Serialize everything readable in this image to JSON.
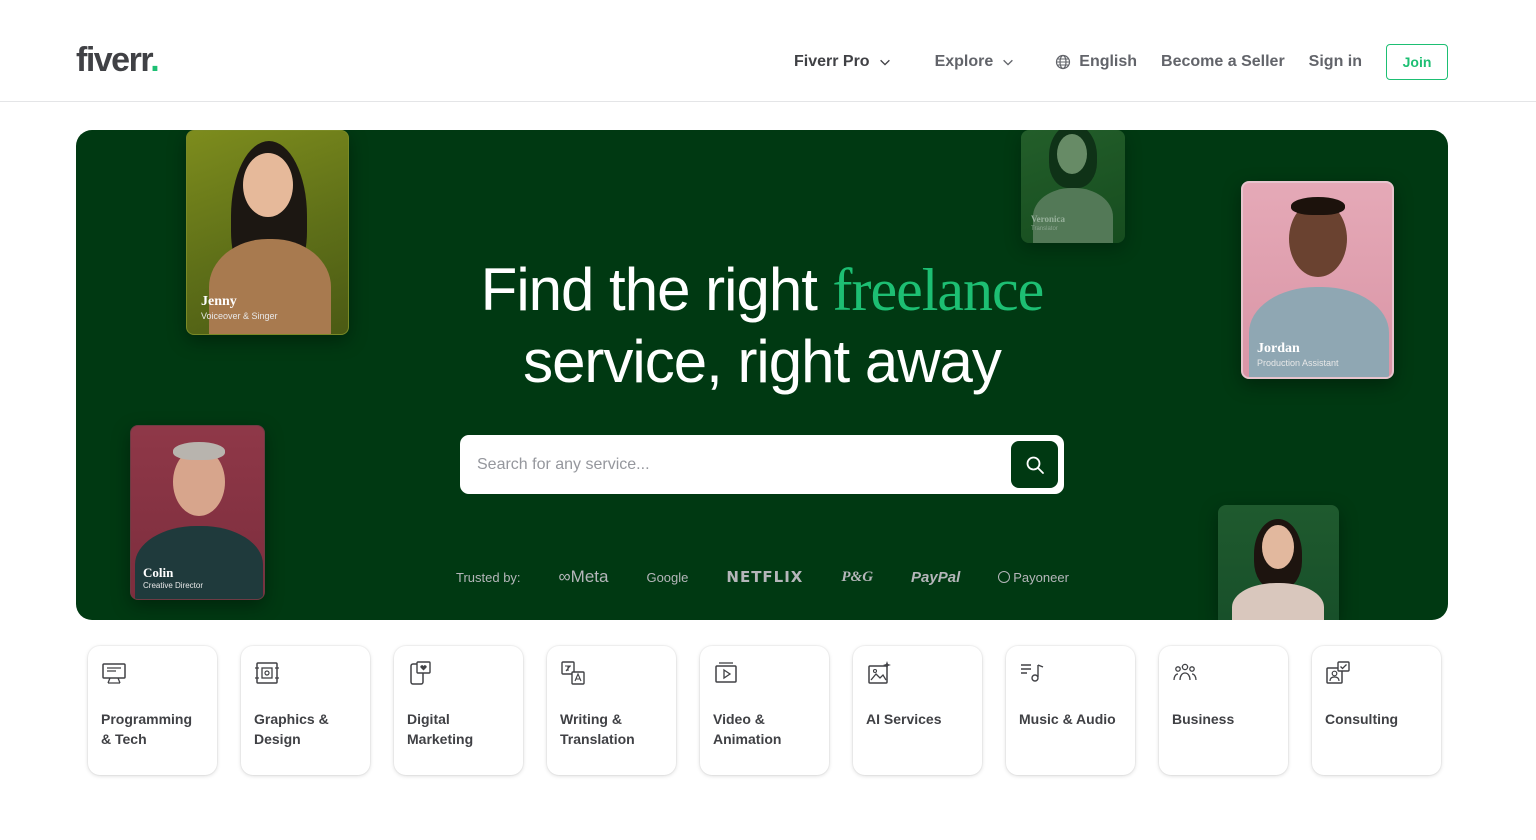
{
  "brand": {
    "logo_text": "fiverr",
    "logo_dot": ".",
    "accent": "#1dbf73",
    "hero_bg": "#003912"
  },
  "nav": {
    "fiverr_pro": "Fiverr Pro",
    "explore": "Explore",
    "language": "English",
    "become_seller": "Become a Seller",
    "sign_in": "Sign in",
    "join": "Join"
  },
  "hero": {
    "title_part1": "Find the right ",
    "title_accent": "freelance",
    "title_part2": "service, right away",
    "search_placeholder": "Search for any service...",
    "trusted_label": "Trusted by:",
    "brands": {
      "meta": "Meta",
      "google": "Google",
      "netflix": "NETFLIX",
      "pg": "P&G",
      "paypal": "PayPal",
      "payoneer": "Payoneer"
    },
    "people": {
      "jenny": {
        "name": "Jenny",
        "role": "Voiceover & Singer"
      },
      "veronica": {
        "name": "Veronica",
        "role": "Translator"
      },
      "jordan": {
        "name": "Jordan",
        "role": "Production Assistant"
      },
      "colin": {
        "name": "Colin",
        "role": "Creative Director"
      }
    }
  },
  "categories": [
    {
      "label": "Programming\n& Tech",
      "icon": "monitor-icon"
    },
    {
      "label": "Graphics &\nDesign",
      "icon": "design-frame-icon"
    },
    {
      "label": "Digital\nMarketing",
      "icon": "phone-heart-icon"
    },
    {
      "label": "Writing &\nTranslation",
      "icon": "translate-icon"
    },
    {
      "label": "Video &\nAnimation",
      "icon": "video-play-icon"
    },
    {
      "label": "AI Services",
      "icon": "ai-image-icon"
    },
    {
      "label": "Music & Audio",
      "icon": "music-note-icon"
    },
    {
      "label": "Business",
      "icon": "people-group-icon"
    },
    {
      "label": "Consulting",
      "icon": "consulting-icon"
    }
  ]
}
